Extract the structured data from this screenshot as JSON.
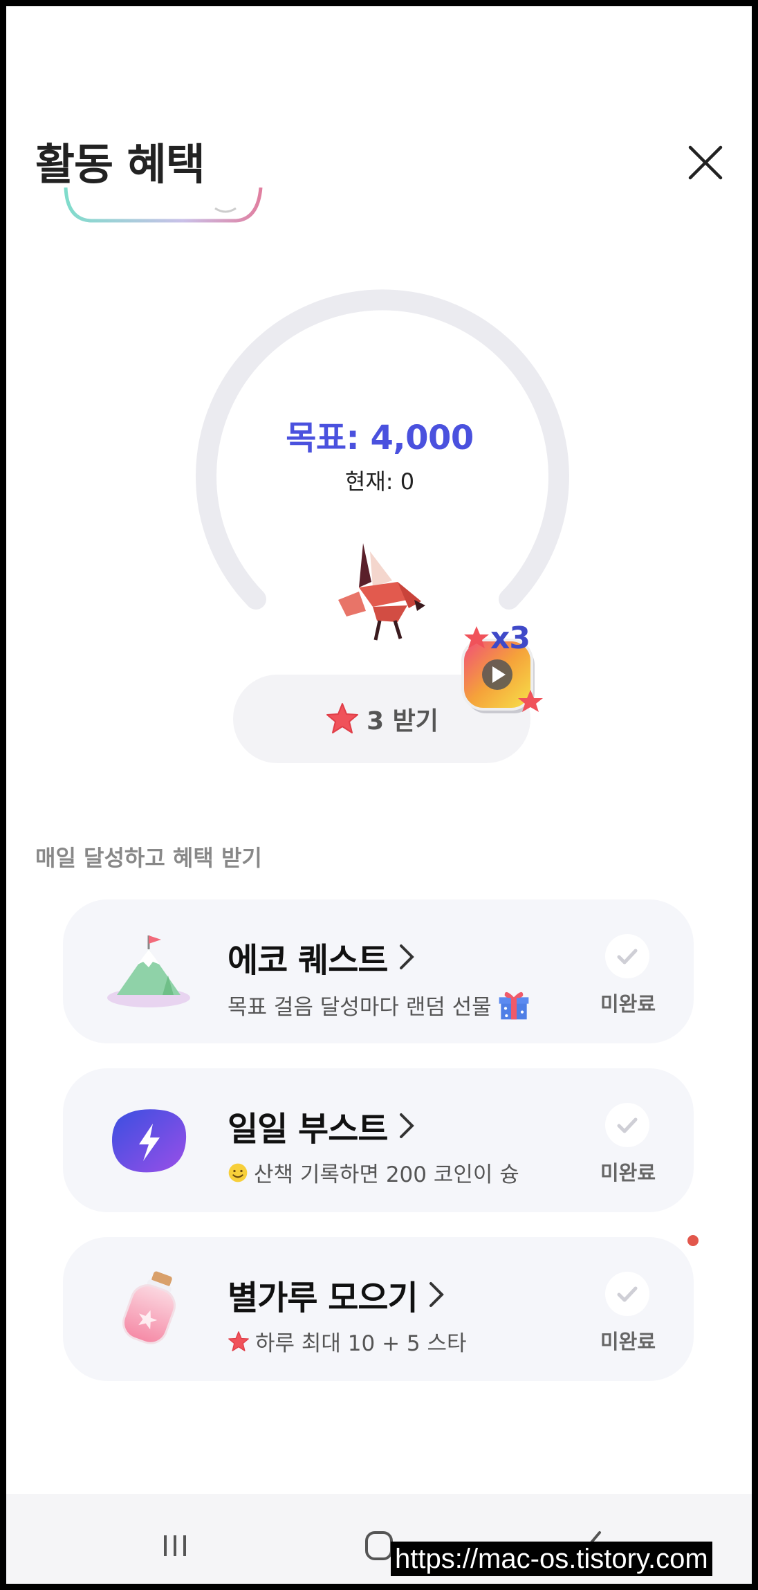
{
  "header": {
    "title": "활동 혜택"
  },
  "goal": {
    "goal_text": "목표: 4,000",
    "current_text": "현재: 0"
  },
  "claim": {
    "label": "3 받기",
    "ad_multiplier": "x3"
  },
  "section": {
    "label": "매일 달성하고 혜택 받기"
  },
  "cards": [
    {
      "title": "에코 퀘스트",
      "desc": "목표 걸음 달성마다 랜덤 선물",
      "status": "미완료",
      "icon": "mountain-flag-icon",
      "desc_icon": "gift-icon"
    },
    {
      "title": "일일 부스트",
      "desc": "산책 기록하면 200 코인이 슝",
      "status": "미완료",
      "icon": "lightning-icon",
      "desc_icon": "smiley-icon"
    },
    {
      "title": "별가루 모으기",
      "desc": "하루 최대 10 + 5 스타",
      "status": "미완료",
      "icon": "star-jar-icon",
      "desc_icon": "star-icon"
    }
  ],
  "watermark": "https://mac-os.tistory.com",
  "colors": {
    "accent": "#4a51de",
    "card_bg": "#f5f6fa",
    "gauge_track": "#ebebf0"
  }
}
